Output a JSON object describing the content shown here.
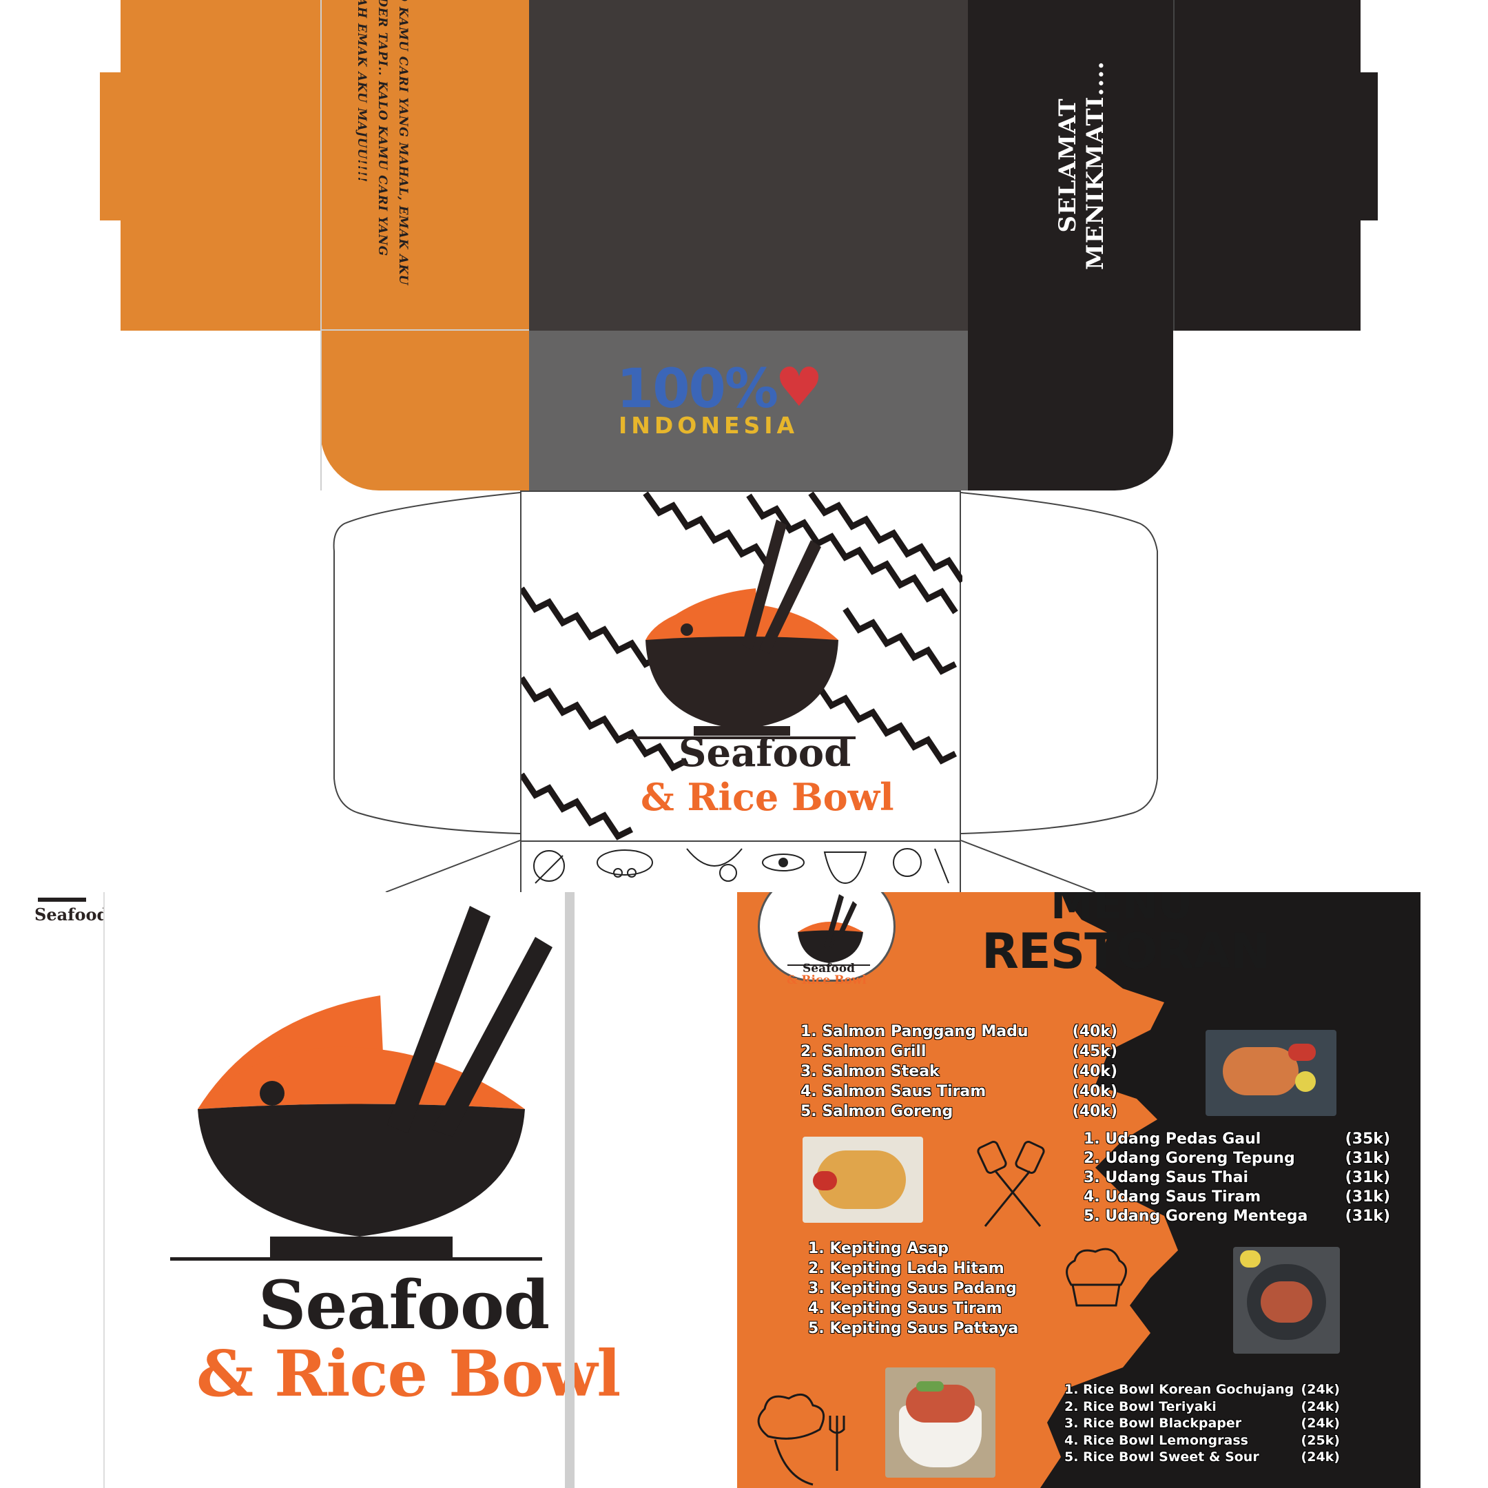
{
  "box": {
    "side_slogan": "KALO KAMU CARI YANG MAHAL, EMAK AKU MENDER TAPI.. KALO KAMU CARI YANG MURAH EMAK AKU MAJUU!!!!",
    "greeting": "SELAMAT MENIKMATI....",
    "badge_percent": "100%",
    "badge_country": "INDONESIA",
    "brand_line1": "Seafood",
    "brand_line2": "& Rice Bowl"
  },
  "logo_page": {
    "tiny_label": "Seafood",
    "brand_line1": "Seafood",
    "brand_line2": "& Rice Bowl"
  },
  "menu": {
    "title_line1": "MENU",
    "title_line2": "RESTORAN",
    "badge_line1": "Seafood",
    "badge_line2": "& Rice Bowl",
    "salmon": [
      {
        "name": "1. Salmon Panggang Madu",
        "price": "(40k)"
      },
      {
        "name": "2. Salmon Grill",
        "price": "(45k)"
      },
      {
        "name": "3. Salmon Steak",
        "price": "(40k)"
      },
      {
        "name": "4. Salmon Saus Tiram",
        "price": "(40k)"
      },
      {
        "name": "5. Salmon Goreng",
        "price": "(40k)"
      }
    ],
    "udang": [
      {
        "name": "1. Udang Pedas Gaul",
        "price": "(35k)"
      },
      {
        "name": "2. Udang Goreng Tepung",
        "price": "(31k)"
      },
      {
        "name": "3. Udang Saus Thai",
        "price": "(31k)"
      },
      {
        "name": "4. Udang Saus Tiram",
        "price": "(31k)"
      },
      {
        "name": "5. Udang Goreng Mentega",
        "price": "(31k)"
      }
    ],
    "kepiting": [
      {
        "name": "1. Kepiting Asap",
        "price": ""
      },
      {
        "name": "2. Kepiting Lada Hitam",
        "price": ""
      },
      {
        "name": "3. Kepiting Saus Padang",
        "price": ""
      },
      {
        "name": "4. Kepiting Saus Tiram",
        "price": ""
      },
      {
        "name": "5. Kepiting Saus Pattaya",
        "price": ""
      }
    ],
    "ricebowl": [
      {
        "name": "1. Rice Bowl Korean Gochujang",
        "price": "(24k)"
      },
      {
        "name": "2. Rice Bowl Teriyaki",
        "price": "(24k)"
      },
      {
        "name": "3. Rice Bowl Blackpaper",
        "price": "(24k)"
      },
      {
        "name": "4. Rice Bowl Lemongrass",
        "price": "(25k)"
      },
      {
        "name": "5. Rice Bowl Sweet & Sour",
        "price": "(24k)"
      }
    ]
  },
  "colors": {
    "orange": "#e18630",
    "brand_orange": "#ef6a2b",
    "dark": "#231f1f",
    "charcoal": "#3f3a39",
    "grey": "#656464"
  }
}
